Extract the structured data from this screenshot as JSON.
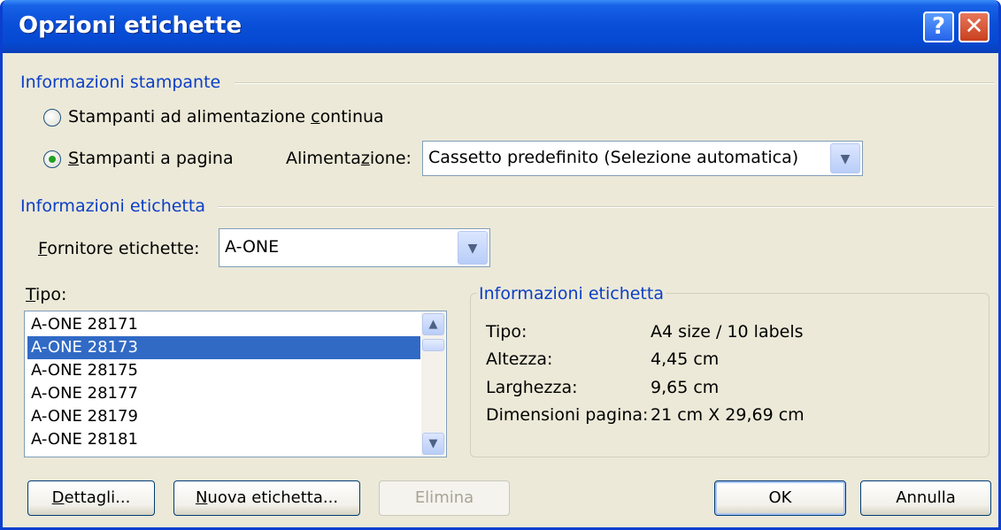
{
  "window": {
    "title": "Opzioni etichette",
    "help_glyph": "?",
    "close_glyph": "✕"
  },
  "printer": {
    "group_title": "Informazioni stampante",
    "continuous_label_pre": "Stampanti ad alimentazione ",
    "continuous_label_u": "c",
    "continuous_label_post": "ontinua",
    "page_label_u": "S",
    "page_label_post": "tampanti a pagina",
    "selected": "page",
    "feed_label_pre": "Alimenta",
    "feed_label_u": "z",
    "feed_label_post": "ione:",
    "feed_value": "Cassetto predefinito (Selezione automatica)"
  },
  "label_info": {
    "group_title": "Informazioni etichetta",
    "vendor_label_u": "F",
    "vendor_label_post": "ornitore etichette:",
    "vendor_value": "A-ONE"
  },
  "type_list": {
    "label_u": "T",
    "label_post": "ipo:",
    "items": [
      "A-ONE 28171",
      "A-ONE 28173",
      "A-ONE 28175",
      "A-ONE 28177",
      "A-ONE 28179",
      "A-ONE 28181"
    ],
    "selected_index": 1
  },
  "details": {
    "title": "Informazioni etichetta",
    "rows": [
      {
        "key": "Tipo:",
        "value": "A4 size / 10 labels"
      },
      {
        "key": "Altezza:",
        "value": "4,45 cm"
      },
      {
        "key": "Larghezza:",
        "value": "9,65 cm"
      },
      {
        "key": "Dimensioni pagina:",
        "value": "21 cm X 29,69 cm"
      }
    ]
  },
  "buttons": {
    "details_u": "D",
    "details_post": "ettagli...",
    "new_u": "N",
    "new_post": "uova etichetta...",
    "delete": "Elimina",
    "ok": "OK",
    "cancel": "Annulla"
  },
  "colors": {
    "accent": "#0b3ec7",
    "selection": "#316ac5",
    "titlebar": "#0549d2"
  }
}
